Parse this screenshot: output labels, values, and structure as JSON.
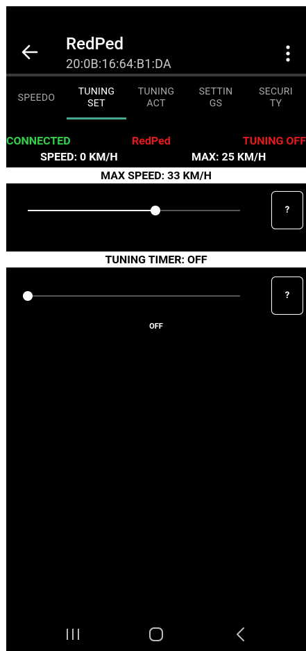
{
  "appbar": {
    "title": "RedPed",
    "subtitle": "20:0B:16:64:B1:DA"
  },
  "tabs": [
    {
      "label": "SPEEDO",
      "active": false
    },
    {
      "label": "TUNING\nSET",
      "active": true
    },
    {
      "label": "TUNING\nACT",
      "active": false
    },
    {
      "label": "SETTIN\nGS",
      "active": false
    },
    {
      "label": "SECURI\nTY",
      "active": false
    }
  ],
  "status": {
    "connection": "CONNECTED",
    "device": "RedPed",
    "tuning": "TUNING OFF",
    "speed": "SPEED: 0 KM/H",
    "max": "MAX: 25 KM/H"
  },
  "max_speed": {
    "header": "MAX SPEED: 33 KM/H",
    "slider_fraction": 0.6,
    "help_label": "?"
  },
  "tuning_timer": {
    "header": "TUNING TIMER: OFF",
    "slider_fraction": 0.0,
    "value_label": "OFF",
    "help_label": "?"
  },
  "icons": {
    "back": "arrow-back-icon",
    "overflow": "more-vert-icon",
    "nav_recents": "recents-icon",
    "nav_home": "home-icon",
    "nav_back": "back-chevron-icon"
  },
  "colors": {
    "connected": "#2fd24a",
    "alert": "#e3191b",
    "tab_indicator": "#46a892"
  }
}
